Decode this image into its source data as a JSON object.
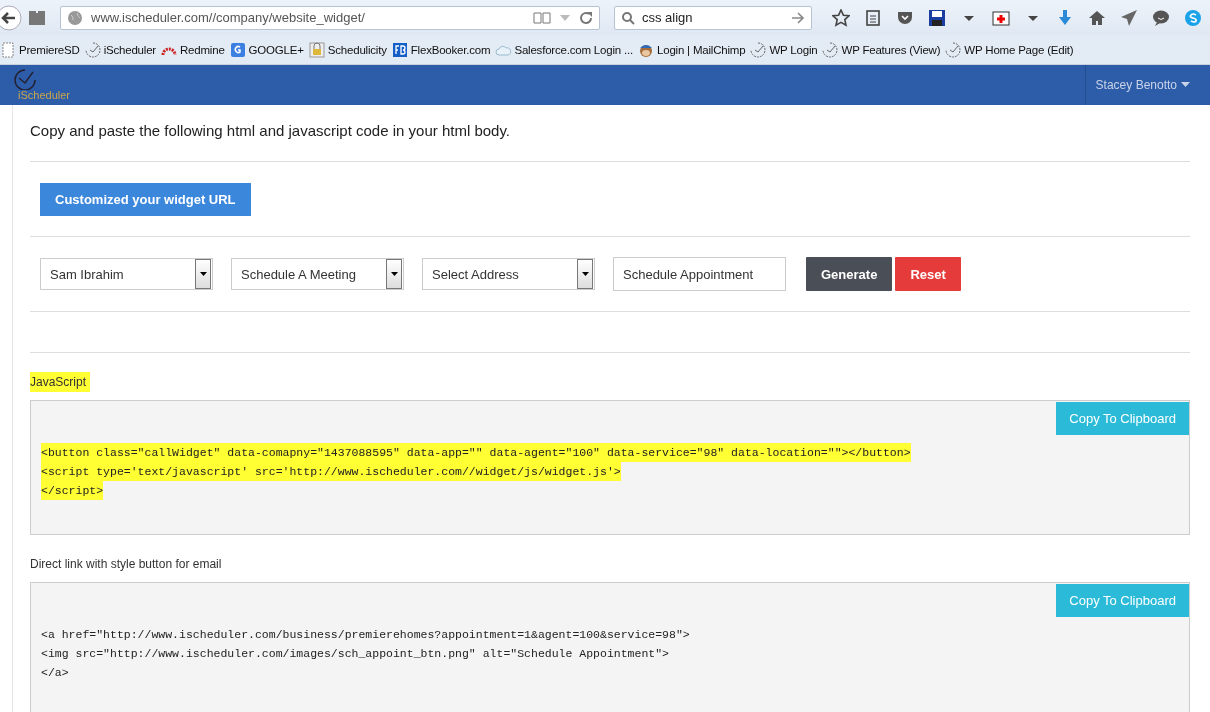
{
  "browser": {
    "url": "www.ischeduler.com//company/website_widget/",
    "search": "css align",
    "bookmarks": [
      {
        "label": "PremiereSD",
        "kind": "page"
      },
      {
        "label": "iScheduler",
        "kind": "clock"
      },
      {
        "label": "Redmine",
        "kind": "redmine"
      },
      {
        "label": "GOOGLE+",
        "kind": "google"
      },
      {
        "label": "Schedulicity",
        "kind": "lock"
      },
      {
        "label": "FlexBooker.com",
        "kind": "fb"
      },
      {
        "label": "Salesforce.com Login ...",
        "kind": "cloud"
      },
      {
        "label": "Login | MailChimp",
        "kind": "chimp"
      },
      {
        "label": "WP Login",
        "kind": "clock"
      },
      {
        "label": "WP Features (View)",
        "kind": "clock"
      },
      {
        "label": "WP Home Page (Edit)",
        "kind": "clock"
      }
    ]
  },
  "navbar": {
    "logo": "iScheduler",
    "user": "Stacey Benotto"
  },
  "intro": "Copy and paste the following html and javascript code in your html body.",
  "url_button": "Customized your widget URL",
  "form": {
    "selects": [
      "Sam Ibrahim",
      "Schedule A Meeting",
      "Select Address"
    ],
    "text_field": "Schedule Appointment",
    "buttons": [
      {
        "label": "Generate",
        "kind": "dark"
      },
      {
        "label": "Reset",
        "kind": "danger"
      }
    ]
  },
  "snippets": [
    {
      "label": "JavaScript",
      "highlighted": true,
      "copy_button": "Copy To Clipboard",
      "lines": [
        "<button class=\"callWidget\" data-comapny=\"1437088595\" data-app=\"\" data-agent=\"100\" data-service=\"98\" data-location=\"\"></button>",
        "<script type='text/javascript' src='http://www.ischeduler.com//widget/js/widget.js'>",
        "</script>"
      ]
    },
    {
      "label": "Direct link with style button for email",
      "highlighted": false,
      "copy_button": "Copy To Clipboard",
      "lines": [
        "<a href=\"http://www.ischeduler.com/business/premierehomes?appointment=1&agent=100&service=98\">",
        "<img src=\"http://www.ischeduler.com/images/sch_appoint_btn.png\" alt=\"Schedule Appointment\">",
        "</a>"
      ]
    }
  ]
}
